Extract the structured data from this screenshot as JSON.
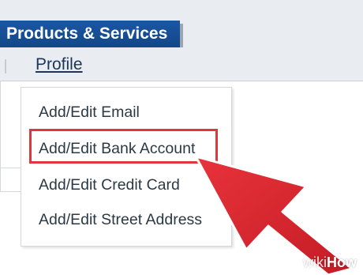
{
  "header": {
    "tab_label": "Products & Services",
    "nav_link": "Profile"
  },
  "dropdown": {
    "items": [
      {
        "label": "Add/Edit Email"
      },
      {
        "label": "Add/Edit Bank Account",
        "highlighted": true
      },
      {
        "label": "Add/Edit Credit Card"
      },
      {
        "label": "Add/Edit Street Address"
      }
    ]
  },
  "annotation": {
    "highlight_color": "#e0363e",
    "arrow_color": "#d7232c",
    "arrow_icon": "pointer-arrow-icon"
  },
  "watermark": {
    "part1": "wiki",
    "part2": "How"
  },
  "colors": {
    "tab_bg": "#1c56a2",
    "nav_bg": "#e9edf2"
  }
}
